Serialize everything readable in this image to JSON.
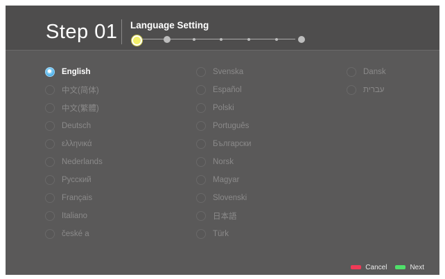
{
  "header": {
    "step_title": "Step 01",
    "setting_title": "Language Setting",
    "progress": {
      "current_step": 1,
      "total_steps": 7
    }
  },
  "languages": {
    "selected": "English",
    "column1": [
      "English",
      "中文(简体)",
      "中文(繁體)",
      "Deutsch",
      "ελληνικά",
      "Nederlands",
      "Русский",
      "Français",
      "Italiano",
      "české a"
    ],
    "column2": [
      "Svenska",
      "Español",
      "Polski",
      "Português",
      "Български",
      "Norsk",
      "Magyar",
      "Slovenski",
      "日本語",
      "Türk"
    ],
    "column3": [
      "Dansk",
      "עברית"
    ]
  },
  "footer": {
    "cancel_label": "Cancel",
    "next_label": "Next"
  },
  "colors": {
    "cancel_key": "#f03a57",
    "next_key": "#4fe06a",
    "selected_radio": "#3ba6e6",
    "active_step": "#f3f06a"
  }
}
